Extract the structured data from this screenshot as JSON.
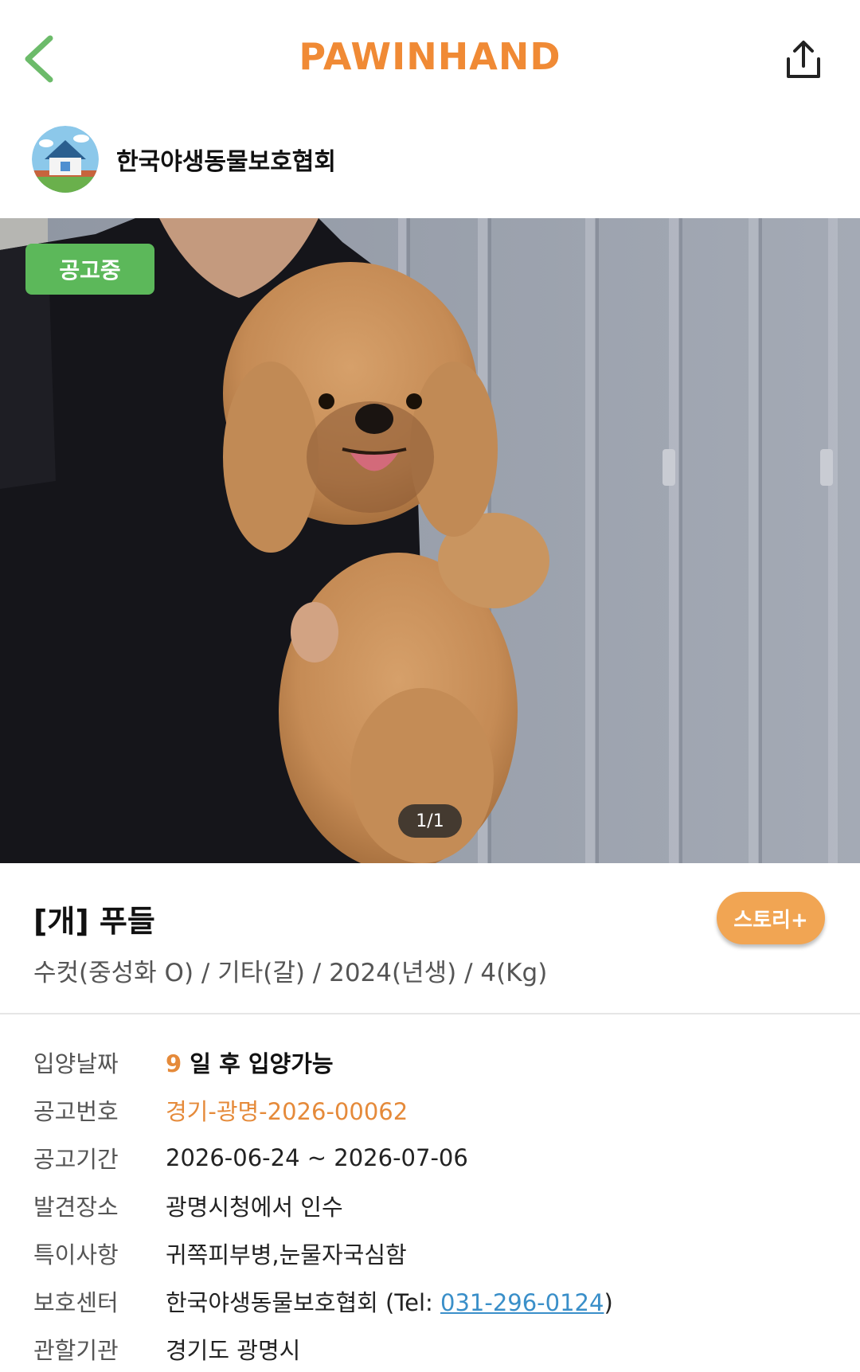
{
  "header": {
    "logo": "PAWINHAND",
    "back_icon": "chevron-left-icon",
    "share_icon": "share-icon"
  },
  "shelter": {
    "name": "한국야생동물보호협회",
    "avatar_icon": "house-icon"
  },
  "photo": {
    "status_badge": "공고중",
    "page_indicator": "1/1"
  },
  "animal": {
    "title": "[개] 푸들",
    "summary": "수컷(중성화 O) / 기타(갈) / 2024(년생) / 4(Kg)",
    "story_button": "스토리+"
  },
  "details": {
    "adoption": {
      "label": "입양날짜",
      "days": "9",
      "text": "일 후 입양가능"
    },
    "notice_no": {
      "label": "공고번호",
      "value": "경기-광명-2026-00062"
    },
    "notice_period": {
      "label": "공고기간",
      "value": "2026-06-24 ~ 2026-07-06"
    },
    "found_place": {
      "label": "발견장소",
      "value": "광명시청에서 인수"
    },
    "notes": {
      "label": "특이사항",
      "value": "귀쪽피부병,눈물자국심함"
    },
    "center": {
      "label": "보호센터",
      "name": "한국야생동물보호협회 (Tel: ",
      "tel": "031-296-0124",
      "close": ")"
    },
    "authority": {
      "label": "관할기관",
      "value": "경기도 광명시"
    }
  },
  "colors": {
    "brand_orange": "#f08a35",
    "badge_green": "#5cb85a",
    "back_green": "#6cbb6a",
    "link_blue": "#3a8fc9"
  }
}
